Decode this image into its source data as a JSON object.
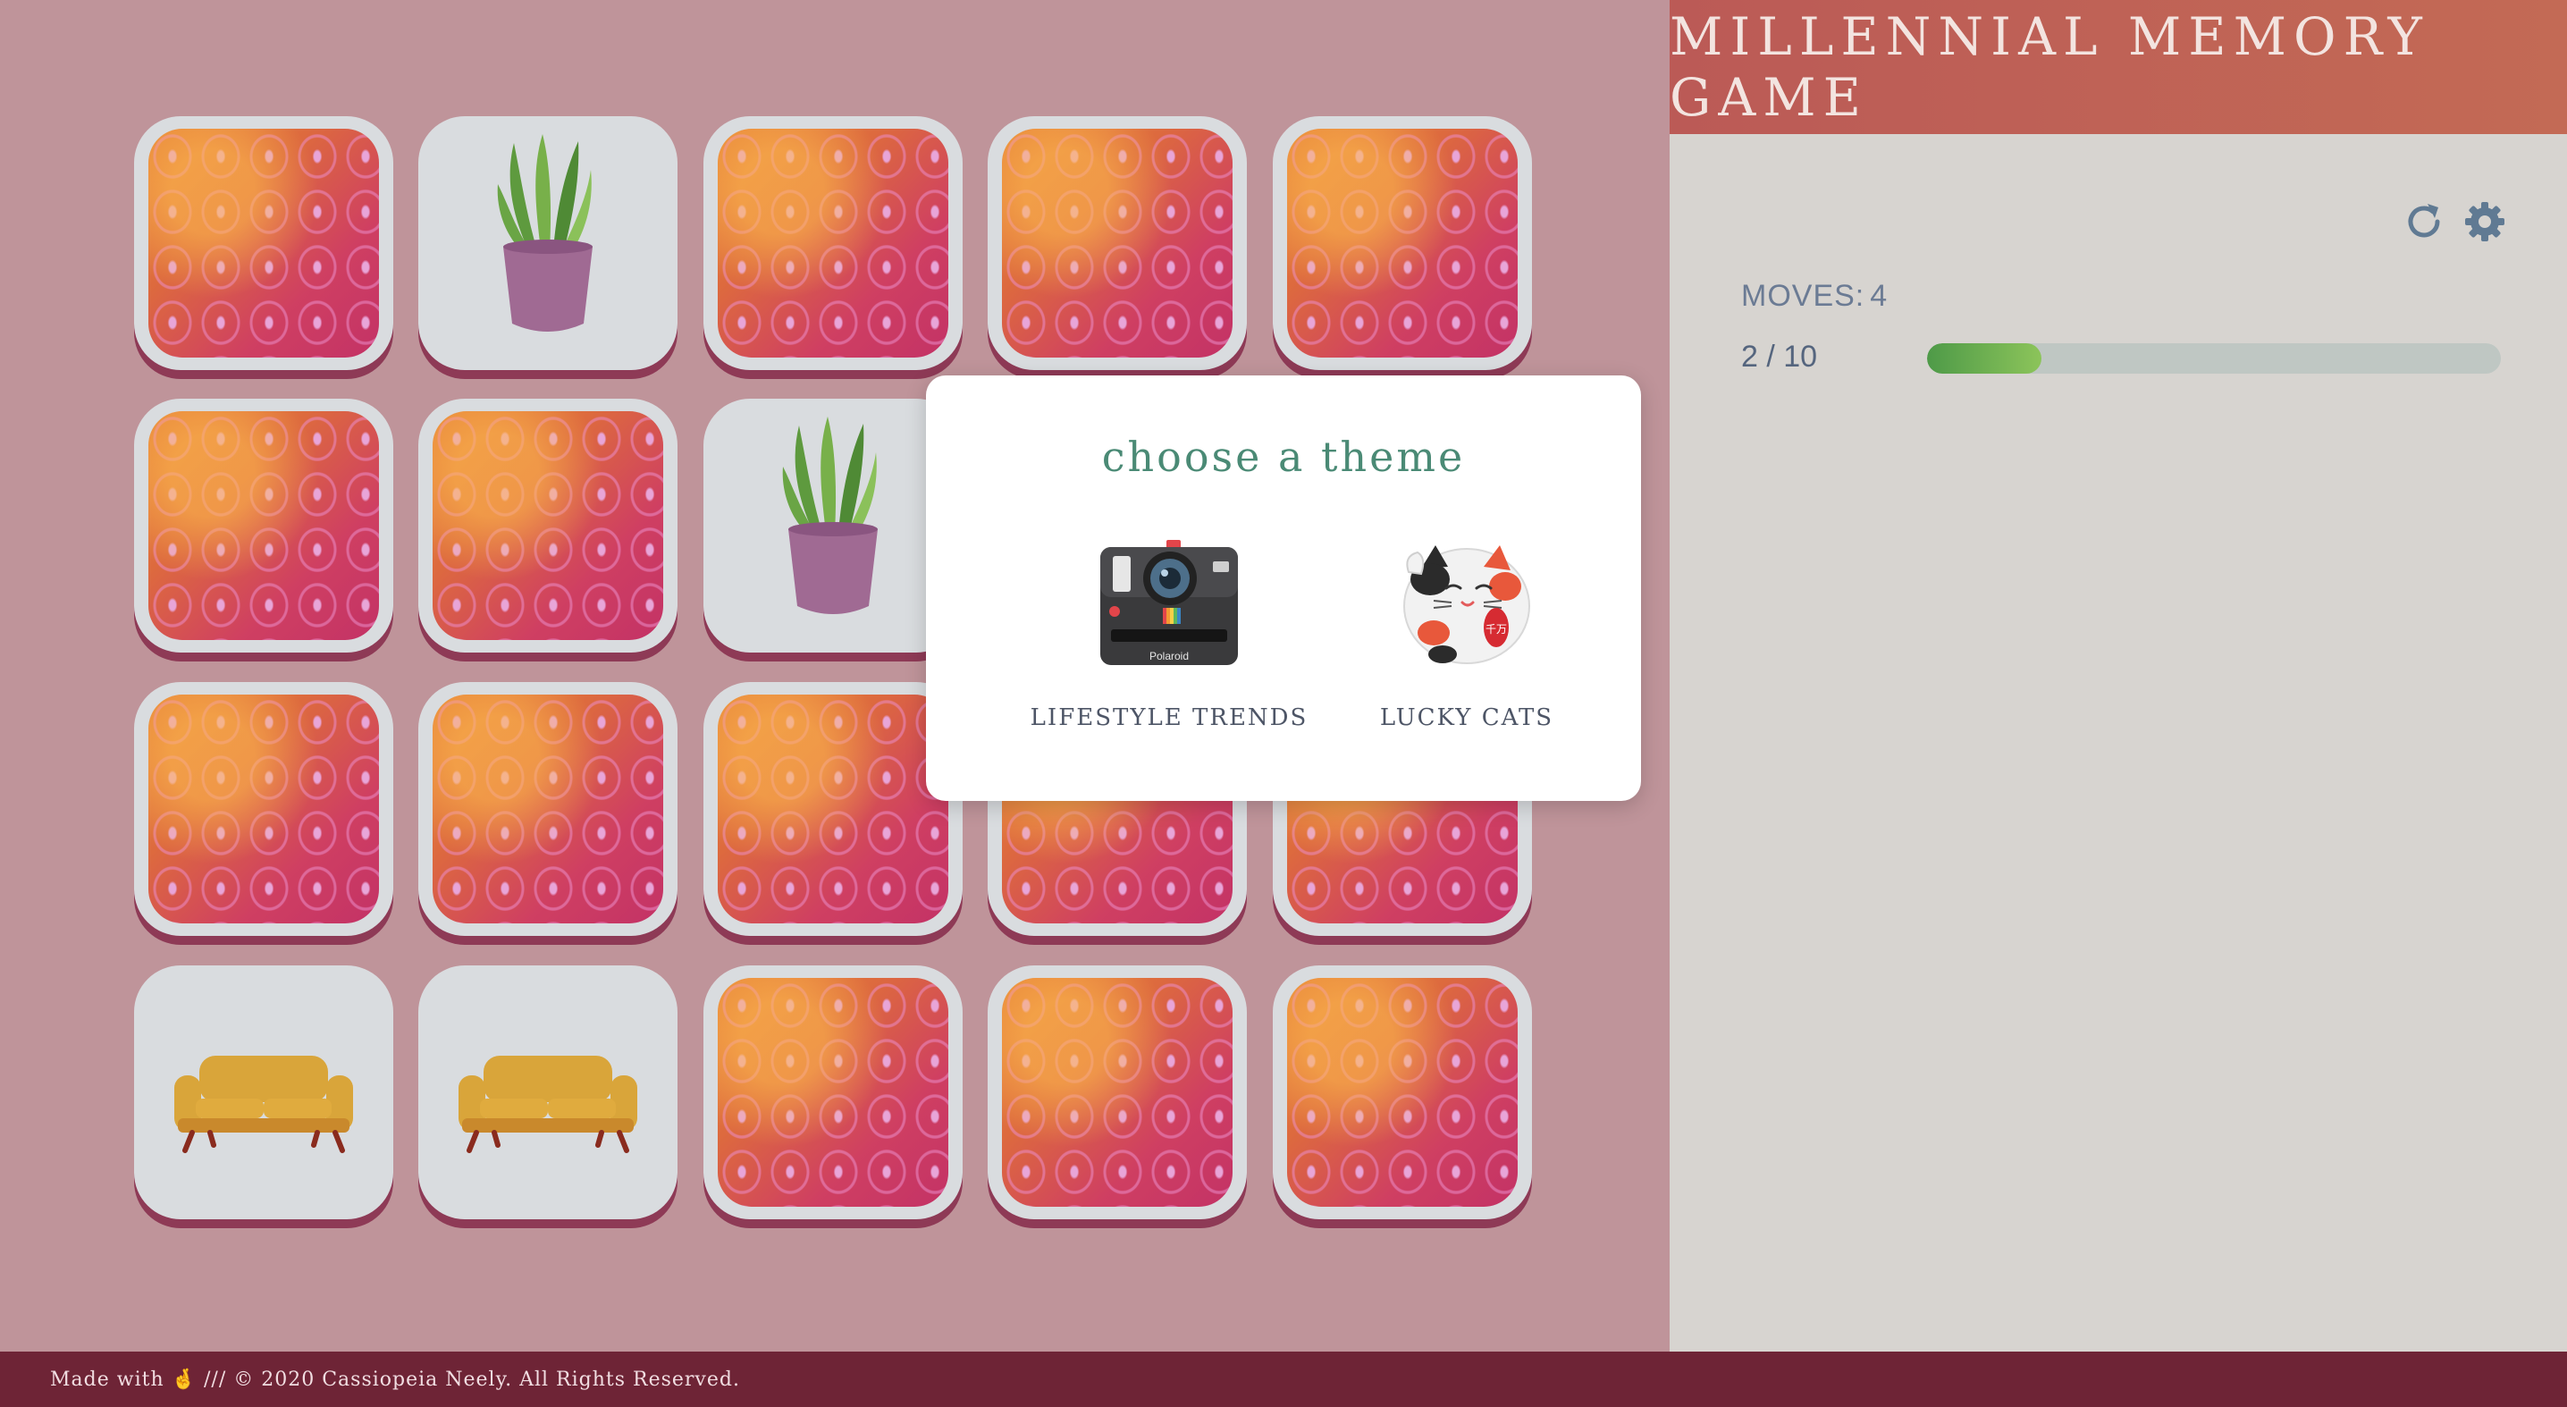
{
  "header": {
    "title": "MILLENNIAL MEMORY GAME"
  },
  "controls": {
    "restart_icon": "restart-icon",
    "settings_icon": "gear-icon"
  },
  "stats": {
    "moves_label": "MOVES:",
    "moves_value": "4",
    "progress_text": "2 / 10",
    "progress_fraction": 0.2
  },
  "board": {
    "columns": 5,
    "rows": 4,
    "cards": [
      {
        "state": "down"
      },
      {
        "state": "up",
        "face": "plant"
      },
      {
        "state": "down"
      },
      {
        "state": "down"
      },
      {
        "state": "down"
      },
      {
        "state": "down"
      },
      {
        "state": "down"
      },
      {
        "state": "up",
        "face": "plant"
      },
      {
        "state": "down"
      },
      {
        "state": "down"
      },
      {
        "state": "down"
      },
      {
        "state": "down"
      },
      {
        "state": "down"
      },
      {
        "state": "down"
      },
      {
        "state": "down"
      },
      {
        "state": "up",
        "face": "sofa"
      },
      {
        "state": "up",
        "face": "sofa"
      },
      {
        "state": "down"
      },
      {
        "state": "down"
      },
      {
        "state": "down"
      }
    ]
  },
  "modal": {
    "title": "choose a theme",
    "themes": [
      {
        "label": "LIFESTYLE TRENDS",
        "icon": "polaroid-camera-icon",
        "camera_text": "Polaroid"
      },
      {
        "label": "LUCKY CATS",
        "icon": "lucky-cat-icon",
        "cat_text": "千万"
      }
    ]
  },
  "footer": {
    "text": "Made with 🤞 /// © 2020 Cassiopeia Neely. All Rights Reserved."
  },
  "colors": {
    "board_bg": "#bf949a",
    "panel_bg": "#d7d4d0",
    "header_bg": "#bb5a56",
    "footer_bg": "#6e2436",
    "progress_fill": "#6fb350",
    "accent_title": "#4a8a75"
  }
}
